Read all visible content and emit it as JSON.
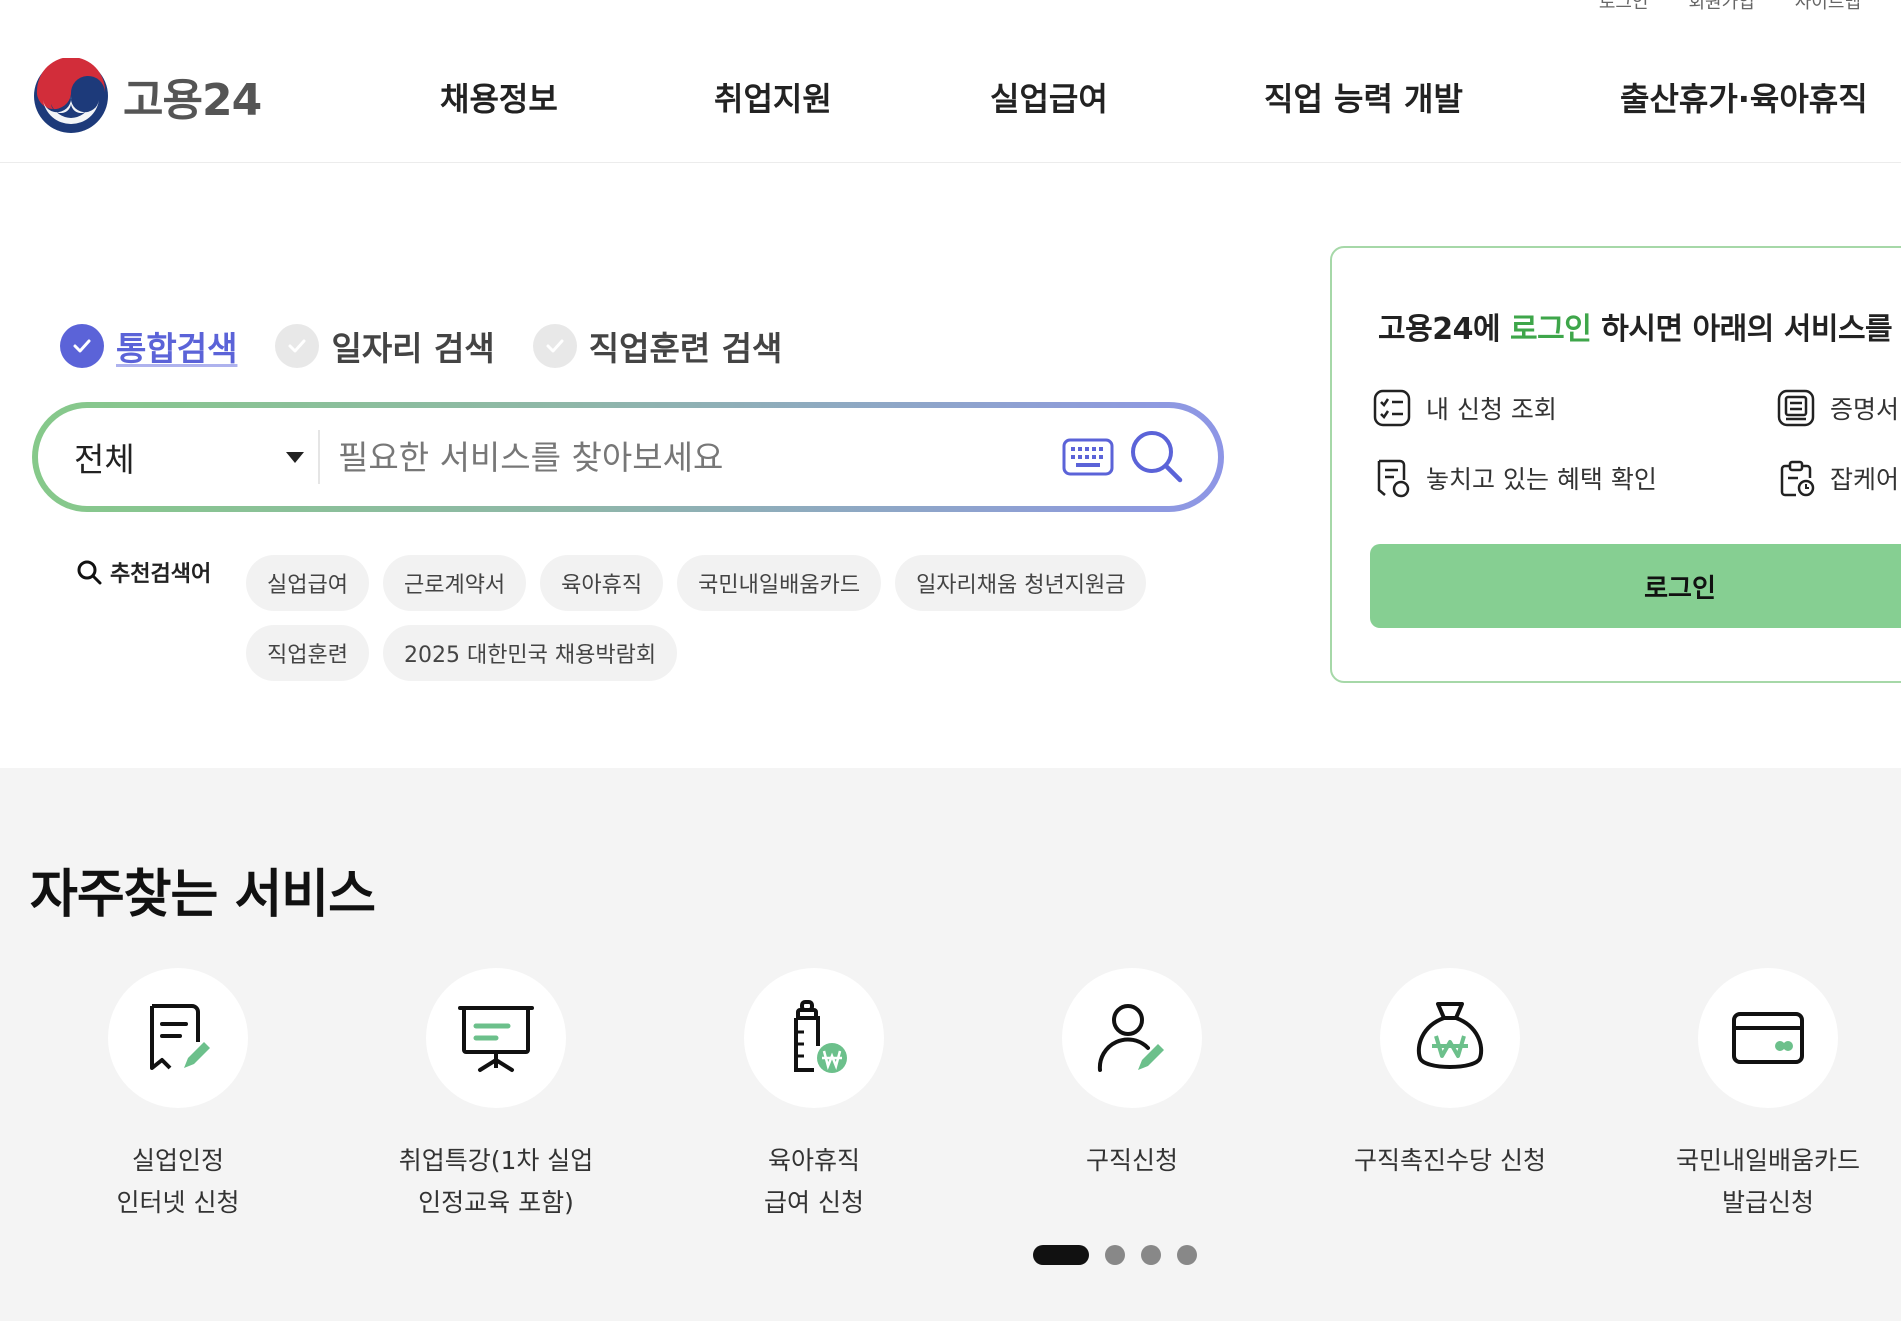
{
  "utility": [
    "로그인",
    "회원가입",
    "사이트맵"
  ],
  "logo": {
    "text": "고용24"
  },
  "gnb": [
    "채용정보",
    "취업지원",
    "실업급여",
    "직업 능력 개발",
    "출산휴가·육아휴직"
  ],
  "search": {
    "tabs": [
      {
        "label": "통합검색",
        "active": true
      },
      {
        "label": "일자리 검색",
        "active": false
      },
      {
        "label": "직업훈련 검색",
        "active": false
      }
    ],
    "select_value": "전체",
    "placeholder": "필요한 서비스를 찾아보세요",
    "recommend_label": "추천검색어",
    "chips": [
      "실업급여",
      "근로계약서",
      "육아휴직",
      "국민내일배움카드",
      "일자리채움 청년지원금",
      "직업훈련",
      "2025 대한민국 채용박람회"
    ]
  },
  "login_card": {
    "title_pre": "고용24에 ",
    "title_highlight": "로그인",
    "title_post": " 하시면 아래의 서비스를",
    "items": [
      "내 신청 조회",
      "증명서",
      "놓치고 있는 혜택 확인",
      "잡케어"
    ],
    "button": "로그인"
  },
  "services": {
    "title": "자주찾는 서비스",
    "items": [
      {
        "label": "실업인정\n인터넷 신청",
        "icon": "document-pen-icon"
      },
      {
        "label": "취업특강(1차 실업\n인정교육 포함)",
        "icon": "presentation-board-icon"
      },
      {
        "label": "육아휴직\n급여 신청",
        "icon": "baby-bottle-won-icon"
      },
      {
        "label": "구직신청",
        "icon": "person-pen-icon"
      },
      {
        "label": "구직촉진수당 신청",
        "icon": "money-bag-icon"
      },
      {
        "label": "국민내일배움카드\n발급신청",
        "icon": "card-icon"
      }
    ],
    "pagination": {
      "total": 4,
      "current": 1
    }
  },
  "colors": {
    "accent_purple": "#5b63d8",
    "accent_green": "#3ea64a",
    "login_button": "#86cf92"
  }
}
